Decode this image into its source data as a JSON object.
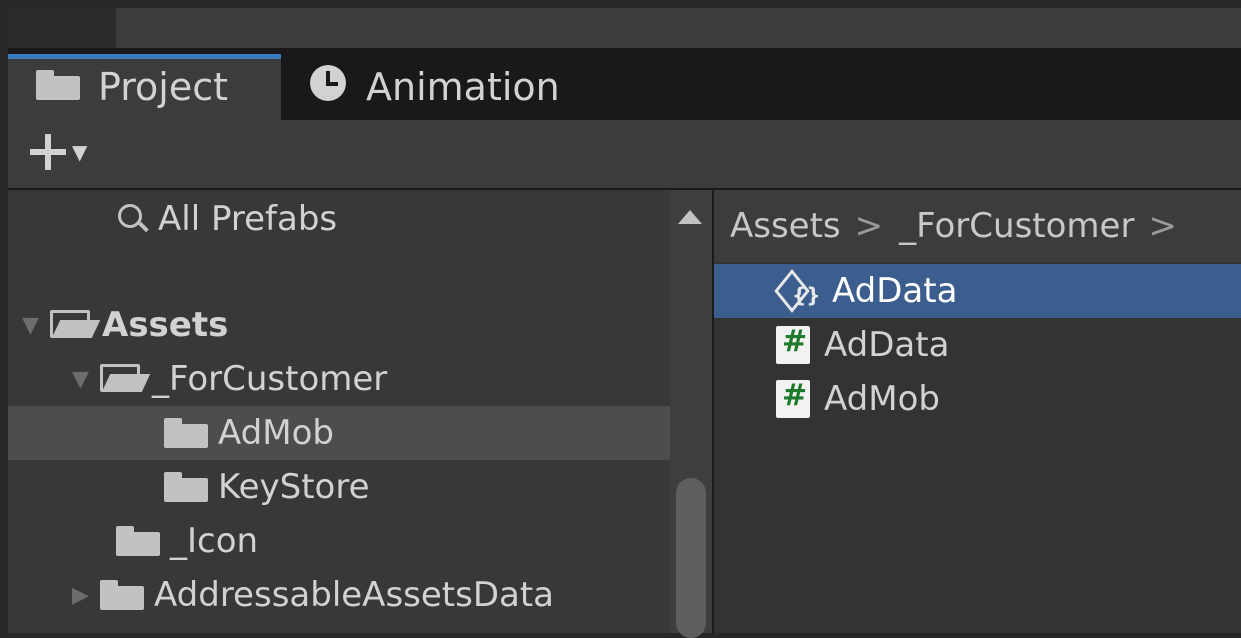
{
  "tabs": [
    {
      "label": "Project",
      "icon": "folder-icon",
      "active": true
    },
    {
      "label": "Animation",
      "icon": "clock-icon",
      "active": false
    }
  ],
  "toolbar": {
    "add_icon": "plus-icon",
    "add_dropdown_icon": "caret-down-icon"
  },
  "tree": {
    "search_label": "All Prefabs",
    "items": [
      {
        "label": "Assets",
        "expanded": true,
        "bold": true
      },
      {
        "label": "_ForCustomer",
        "expanded": true
      },
      {
        "label": "AdMob",
        "selected": true
      },
      {
        "label": "KeyStore"
      },
      {
        "label": "_Icon"
      },
      {
        "label": "AddressableAssetsData",
        "expanded": false
      }
    ]
  },
  "breadcrumb": {
    "root": "Assets",
    "folder": "_ForCustomer",
    "separator": ">"
  },
  "files": [
    {
      "label": "AdData",
      "icon": "scriptable-object-icon",
      "selected": true
    },
    {
      "label": "AdData",
      "icon": "csharp-script-icon"
    },
    {
      "label": "AdMob",
      "icon": "csharp-script-icon"
    }
  ],
  "colors": {
    "accent": "#3a79bb",
    "selection": "#3c5e8f",
    "script_hash": "#1e7a2c"
  }
}
